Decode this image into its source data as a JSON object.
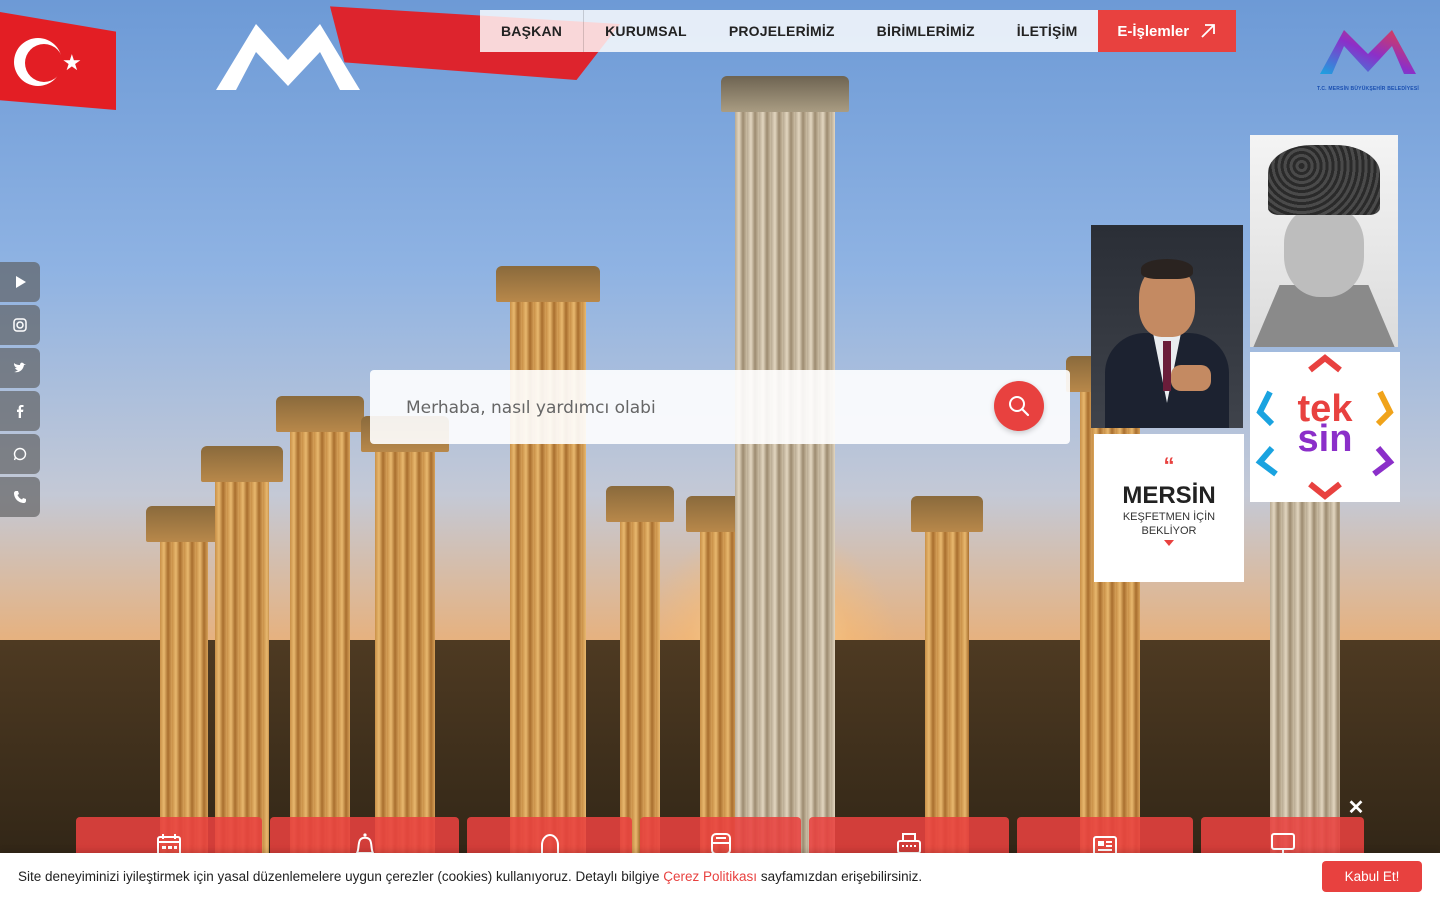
{
  "nav": {
    "items": [
      {
        "label": "BAŞKAN"
      },
      {
        "label": "KURUMSAL"
      },
      {
        "label": "PROJELERİMİZ"
      },
      {
        "label": "BİRİMLERİMİZ"
      },
      {
        "label": "İLETİŞİM"
      }
    ],
    "eislemler_label": "E-İşlemler"
  },
  "corner_logo": {
    "caption": "T.C. MERSİN BÜYÜKŞEHİR BELEDİYESİ"
  },
  "social": [
    "play-icon",
    "instagram-icon",
    "twitter-icon",
    "facebook-icon",
    "whatsapp-icon",
    "phone-icon"
  ],
  "search": {
    "placeholder": "Merhaba, nasıl yardımcı olabi"
  },
  "cards": {
    "mersin": {
      "quote": "“",
      "title": "MERSİN",
      "subtitle": "KEŞFETMEN İÇİN BEKLİYOR"
    },
    "teksin": {
      "part1": "tek",
      "part2": "sin"
    }
  },
  "tiles": [
    "calendar-icon",
    "bell-icon",
    "arch-icon",
    "bus-icon",
    "printer-icon",
    "newspaper-icon",
    "monitor-icon"
  ],
  "cookie": {
    "text_before": "Site deneyiminizi iyileştirmek için yasal düzenlemelere uygun çerezler (cookies) kullanıyoruz. Detaylı bilgiye ",
    "link": "Çerez Politikası",
    "text_after": " sayfamızdan erişebilirsiniz.",
    "accept": "Kabul Et!"
  },
  "colors": {
    "accent": "#e8413f",
    "flag_red": "#e31e24"
  }
}
